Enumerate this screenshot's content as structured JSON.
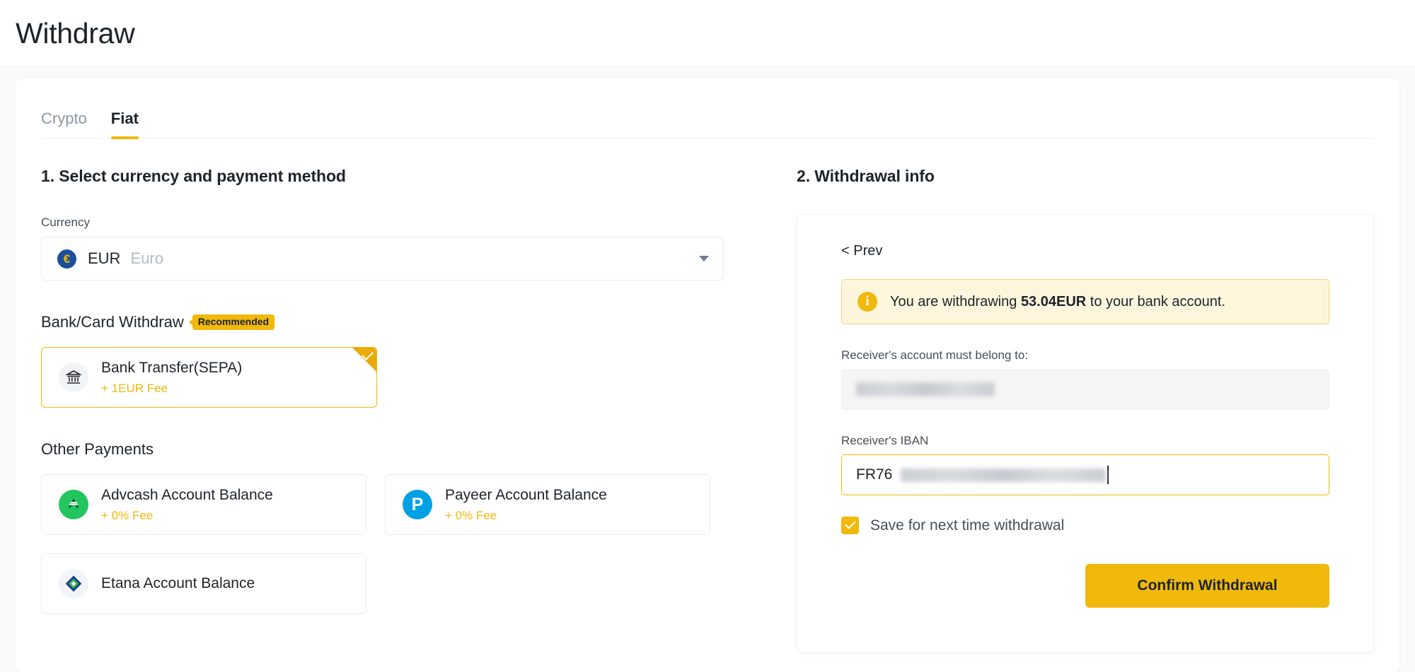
{
  "header": {
    "title": "Withdraw"
  },
  "tabs": [
    {
      "label": "Crypto",
      "active": false
    },
    {
      "label": "Fiat",
      "active": true
    }
  ],
  "left": {
    "heading": "1. Select currency and payment method",
    "currency_label": "Currency",
    "currency": {
      "icon": "eur-coin-icon",
      "icon_glyph": "€",
      "code": "EUR",
      "name": "Euro",
      "chevron": "chevron-down-icon"
    },
    "bank_section": {
      "heading": "Bank/Card Withdraw",
      "badge": "Recommended",
      "methods": [
        {
          "name": "Bank Transfer(SEPA)",
          "fee": "+ 1EUR Fee",
          "icon": "bank-icon",
          "selected": true
        }
      ]
    },
    "other_section": {
      "heading": "Other Payments",
      "methods": [
        {
          "name": "Advcash Account Balance",
          "fee": "+ 0% Fee",
          "icon": "advcash-icon",
          "letter": "A"
        },
        {
          "name": "Payeer Account Balance",
          "fee": "+ 0% Fee",
          "icon": "payeer-icon",
          "letter": "P"
        },
        {
          "name": "Etana Account Balance",
          "fee": "",
          "icon": "etana-icon",
          "letter": ""
        }
      ]
    }
  },
  "right": {
    "heading": "2. Withdrawal info",
    "prev_label": "< Prev",
    "alert": {
      "icon": "info-icon",
      "prefix": "You are withdrawing ",
      "amount": "53.04EUR",
      "suffix": " to your bank account."
    },
    "account_owner_label": "Receiver's account must belong to:",
    "account_owner_value": "",
    "iban_label": "Receiver's IBAN",
    "iban_prefix": "FR76",
    "iban_rest": "",
    "save_checkbox_label": "Save for next time withdrawal",
    "save_checkbox_checked": true,
    "confirm_label": "Confirm Withdrawal"
  },
  "colors": {
    "accent": "#F0B90B",
    "accent_dark": "#EAAA08",
    "alert_bg": "#FDF6DD",
    "alert_border": "#F0D675",
    "text_primary": "#1E2329",
    "text_secondary": "#474D57",
    "text_muted": "#8D96A3",
    "border": "#EAECEF",
    "page_bg": "#FAFAFA",
    "advcash_green": "#22C55E",
    "payeer_blue": "#00A0E4",
    "eur_blue": "#1A4F9C"
  }
}
